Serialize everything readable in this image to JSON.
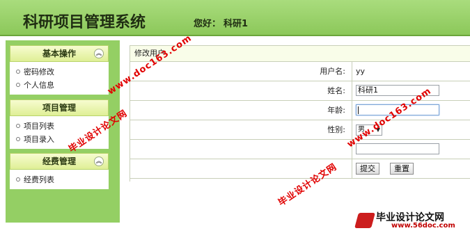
{
  "header": {
    "title": "科研项目管理系统",
    "greeting": "您好：",
    "username": "科研1"
  },
  "sidebar": {
    "panels": [
      {
        "title": "基本操作",
        "items": [
          "密码修改",
          "个人信息"
        ]
      },
      {
        "title": "项目管理",
        "items": [
          "项目列表",
          "项目录入"
        ]
      },
      {
        "title": "经费管理",
        "items": [
          "经费列表"
        ]
      }
    ]
  },
  "form": {
    "title": "修改用户",
    "fields": {
      "username_label": "用户名:",
      "username_value": "yy",
      "name_label": "姓名:",
      "name_value": "科研1",
      "age_label": "年龄:",
      "age_value": "",
      "gender_label": "性别:",
      "gender_value": "男",
      "row5_label": "",
      "row5_value": ""
    },
    "submit_label": "提交",
    "reset_label": "重置"
  },
  "watermarks": {
    "url": "www.doc163.com",
    "cn": "毕业设计论文网",
    "logo_cn": "毕业设计论文网",
    "logo_url": "www.56doc.com"
  },
  "colors": {
    "header_green": "#8cc85a",
    "sidebar_green": "#94cf64",
    "watermark_red": "#e10000"
  }
}
